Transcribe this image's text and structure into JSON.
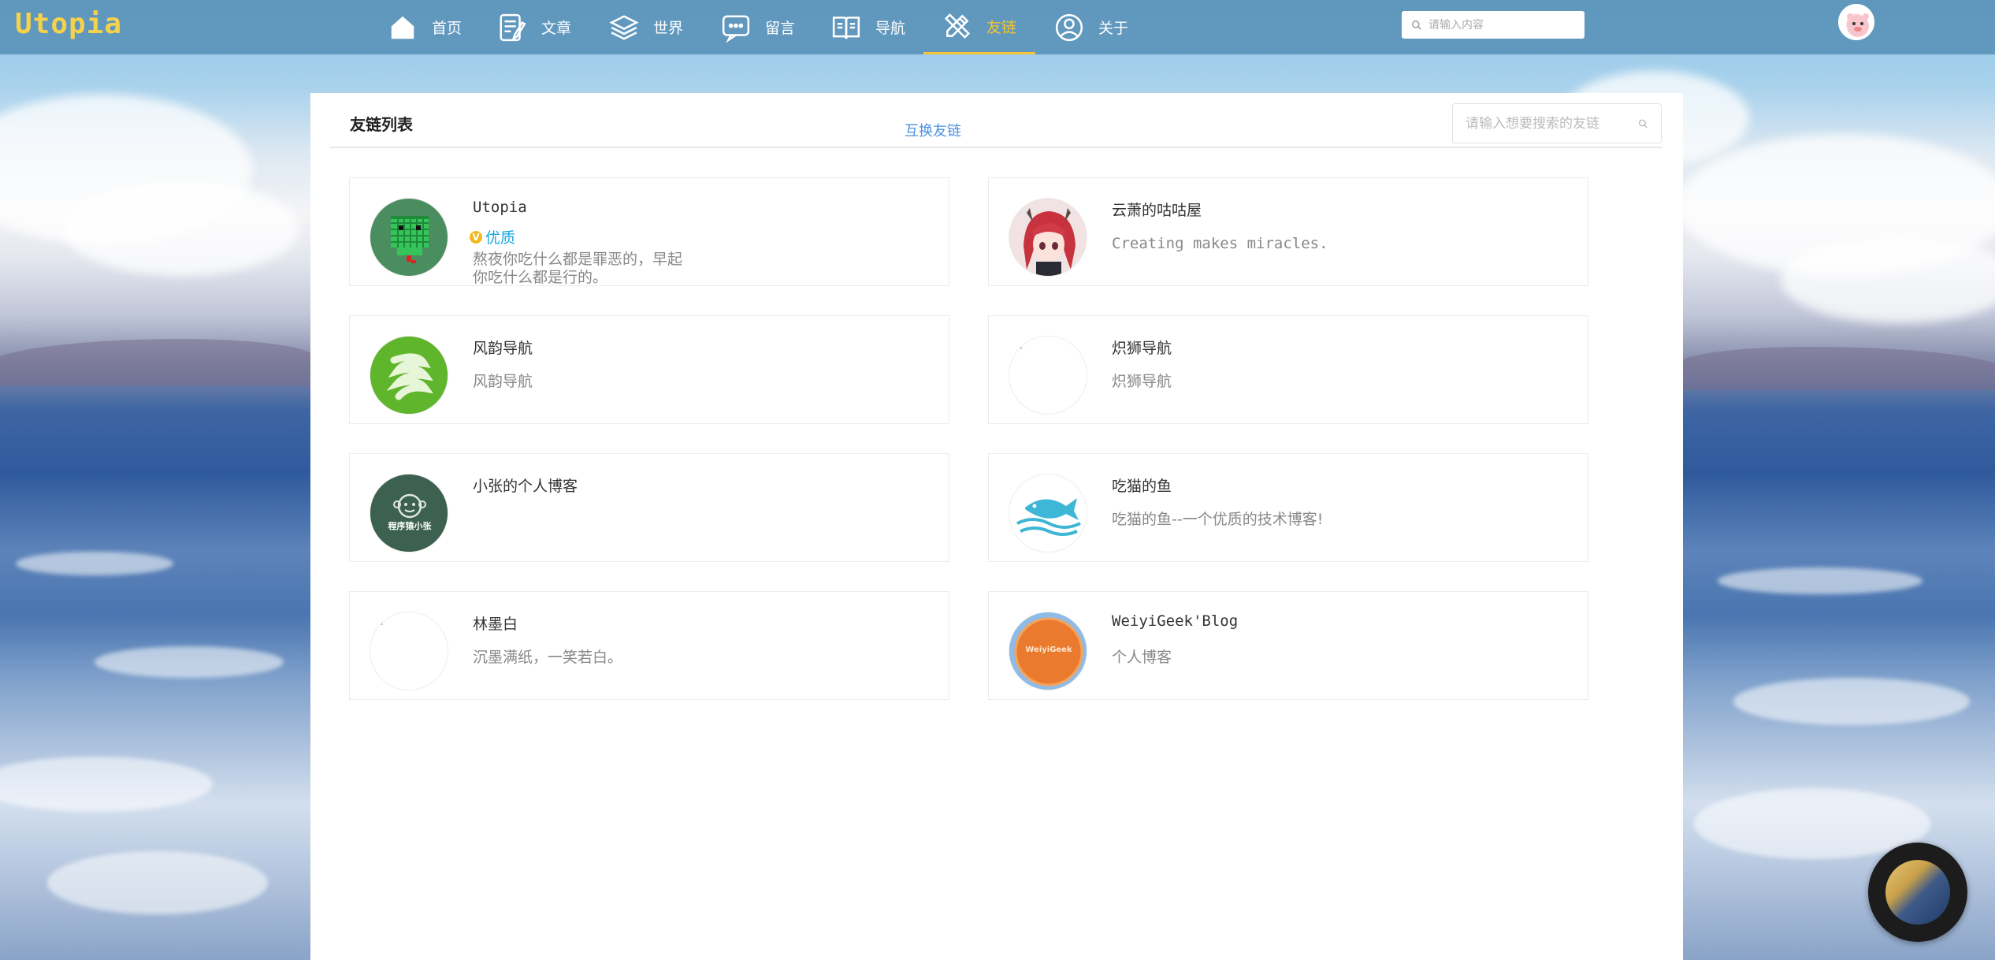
{
  "header": {
    "logo": "Utopia",
    "nav": [
      {
        "label": "首页",
        "icon": "home-icon"
      },
      {
        "label": "文章",
        "icon": "article-icon"
      },
      {
        "label": "世界",
        "icon": "layers-icon"
      },
      {
        "label": "留言",
        "icon": "message-icon"
      },
      {
        "label": "导航",
        "icon": "book-icon"
      },
      {
        "label": "友链",
        "icon": "pencil-ruler-icon",
        "active": true
      },
      {
        "label": "关于",
        "icon": "user-circle-icon"
      }
    ],
    "search_placeholder": "请输入内容",
    "active_color": "#f4c430"
  },
  "panel": {
    "title": "友链列表",
    "exchange_link": "互换友链",
    "search_placeholder": "请输入想要搜索的友链",
    "links": [
      {
        "name": "Utopia",
        "badge": "优质",
        "badge_mark": "V",
        "desc": "熬夜你吃什么都是罪恶的，早起你吃什么都是行的。",
        "avatar": "pixel-snake-avatar"
      },
      {
        "name": "云萧的咕咕屋",
        "desc": "Creating makes miracles.",
        "avatar": "anime-girl-avatar"
      },
      {
        "name": "风韵导航",
        "desc": "风韵导航",
        "avatar": "green-wave-logo"
      },
      {
        "name": "炽狮导航",
        "desc": "炽狮导航",
        "avatar": "broken-image"
      },
      {
        "name": "小张的个人博客",
        "desc": "",
        "avatar": "monkey-logo",
        "avatar_text": "程序猿小张"
      },
      {
        "name": "吃猫的鱼",
        "desc": "吃猫的鱼--一个优质的技术博客!",
        "avatar": "fish-logo"
      },
      {
        "name": "林墨白",
        "desc": "沉墨满纸，一笑若白。",
        "avatar": "broken-image"
      },
      {
        "name": "WeiyiGeek'Blog",
        "desc": "个人博客",
        "avatar": "orange-circle-logo",
        "avatar_text": "WeiyiGeek"
      }
    ]
  },
  "music_player": {
    "icon": "music-disc-icon"
  }
}
